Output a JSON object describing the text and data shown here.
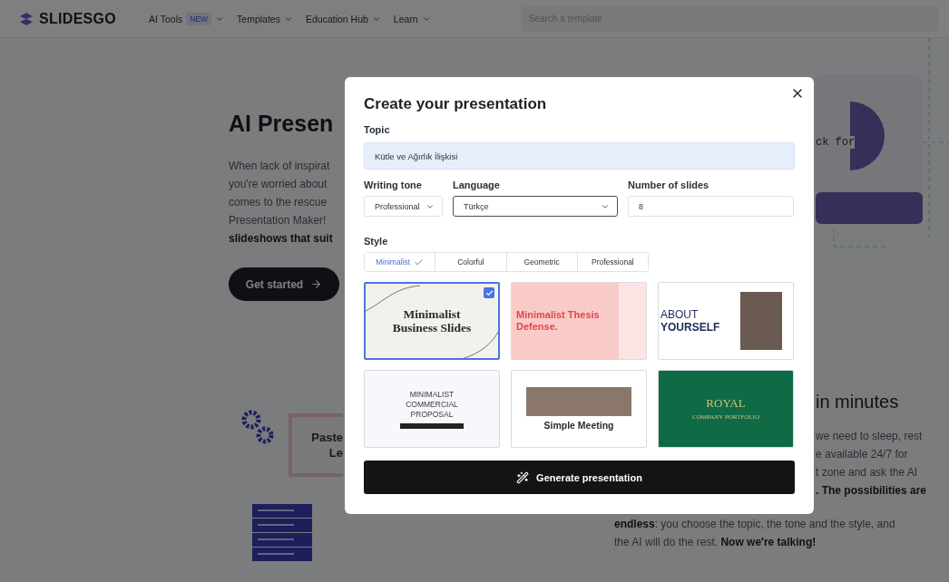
{
  "header": {
    "logo": "SLIDESGO",
    "nav": [
      {
        "label": "AI Tools",
        "badge": "NEW"
      },
      {
        "label": "Templates"
      },
      {
        "label": "Education Hub"
      },
      {
        "label": "Learn"
      }
    ],
    "search": {
      "placeholder": "Search a template"
    }
  },
  "hero": {
    "title": "AI Presen",
    "lines": [
      {
        "text": "When lack of inspirat",
        "bold": false
      },
      {
        "text": "you're worried about",
        "bold": false
      },
      {
        "text": "comes to the rescue",
        "bold": false
      },
      {
        "text": "Presentation Maker!",
        "bold": false
      },
      {
        "text": "slideshows that suit",
        "bold": true
      }
    ],
    "button": "Get started",
    "card_lines": [
      "Paste",
      "Le"
    ]
  },
  "diagram": {
    "code_text": "ck for"
  },
  "feature": {
    "title": "in minutes",
    "lines": [
      {
        "text": "we need to sleep, rest",
        "bold": false
      },
      {
        "text": "e available 24/7 for",
        "bold": false
      },
      {
        "text": "t zone and ask the AI",
        "bold": false
      },
      {
        "text": ". The possibilities are",
        "bold": true
      }
    ],
    "bottom_lines": [
      "**endless**: you choose the topic, the tone and the style, and",
      "the AI will do the rest. **Now we're talking!**"
    ]
  },
  "modal": {
    "title": "Create your presentation",
    "topic": {
      "label": "Topic",
      "value": "Kütle ve Ağırlık İlişkisi"
    },
    "tone": {
      "label": "Writing tone",
      "value": "Professional"
    },
    "language": {
      "label": "Language",
      "value": "Türkçe",
      "focused": true
    },
    "slides": {
      "label": "Number of slides",
      "value": "8"
    },
    "style": {
      "label": "Style",
      "tabs": [
        {
          "label": "Minimalist",
          "selected": true
        },
        {
          "label": "Colorful",
          "selected": false
        },
        {
          "label": "Geometric",
          "selected": false
        },
        {
          "label": "Professional",
          "selected": false
        }
      ]
    },
    "templates": [
      {
        "kind": "serif",
        "title": "Minimalist Business Slides",
        "selected": true
      },
      {
        "kind": "thesis",
        "title": "Minimalist Thesis Defense.",
        "selected": false
      },
      {
        "kind": "about",
        "title": "ABOUT **YOURSELF**",
        "selected": false
      },
      {
        "kind": "commercial",
        "title": "MINIMALIST COMMERCIAL PROPOSAL",
        "selected": false
      },
      {
        "kind": "meeting",
        "title": "Simple Meeting",
        "selected": false
      },
      {
        "kind": "royal",
        "title": "ROYAL",
        "subtitle": "COMPANY PORTFOLIO",
        "selected": false
      }
    ],
    "generate": "Generate presentation"
  }
}
